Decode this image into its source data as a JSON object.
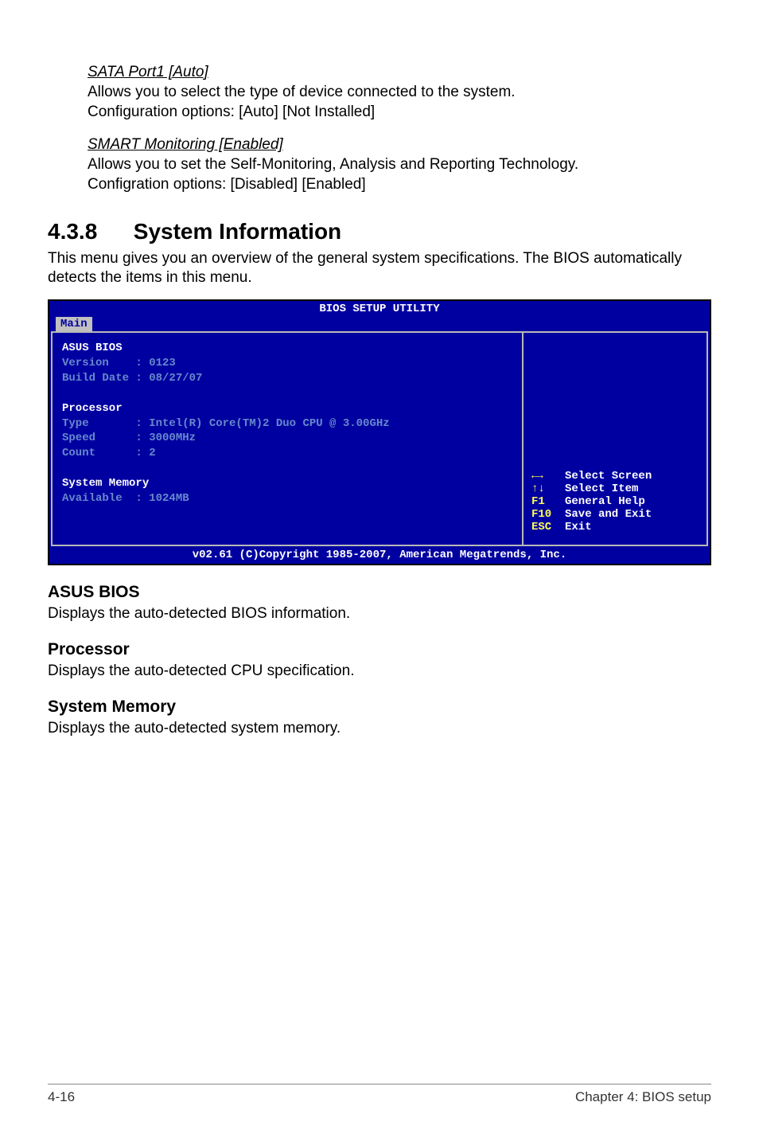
{
  "sata": {
    "heading": "SATA Port1 [Auto]",
    "p1": "Allows you to select the type of device connected to the system.",
    "p2": "Configuration options: [Auto] [Not Installed]"
  },
  "smart": {
    "heading": "SMART Monitoring [Enabled]",
    "p1": "Allows you to set the Self-Monitoring, Analysis and Reporting Technology.",
    "p2": "Configration options: [Disabled] [Enabled]"
  },
  "section": {
    "num": "4.3.8",
    "title": "System Information",
    "intro": "This menu gives you an overview of the general system specifications. The BIOS automatically detects the items in this menu."
  },
  "bios": {
    "title": "BIOS SETUP UTILITY",
    "tab": "Main",
    "asus_bios": "ASUS BIOS",
    "version": "Version    : 0123",
    "build_date": "Build Date : 08/27/07",
    "processor": "Processor",
    "cpu_type": "Type       : Intel(R) Core(TM)2 Duo CPU @ 3.00GHz",
    "cpu_speed": "Speed      : 3000MHz",
    "cpu_count": "Count      : 2",
    "sysmem": "System Memory",
    "available": "Available  : 1024MB",
    "help": {
      "selscreen_key": "←→",
      "selscreen": "Select Screen",
      "selitem_key": "↑↓",
      "selitem": "Select Item",
      "f1_key": "F1",
      "f1": "General Help",
      "f10_key": "F10",
      "f10": "Save and Exit",
      "esc_key": "ESC",
      "esc": "Exit"
    },
    "footer": "v02.61 (C)Copyright 1985-2007, American Megatrends, Inc."
  },
  "subsections": {
    "asusbios_h": "ASUS BIOS",
    "asusbios_p": "Displays the auto-detected BIOS information.",
    "proc_h": "Processor",
    "proc_p": "Displays the auto-detected CPU specification.",
    "mem_h": "System Memory",
    "mem_p": "Displays the auto-detected system memory."
  },
  "footer": {
    "left": "4-16",
    "right": "Chapter 4: BIOS setup"
  }
}
